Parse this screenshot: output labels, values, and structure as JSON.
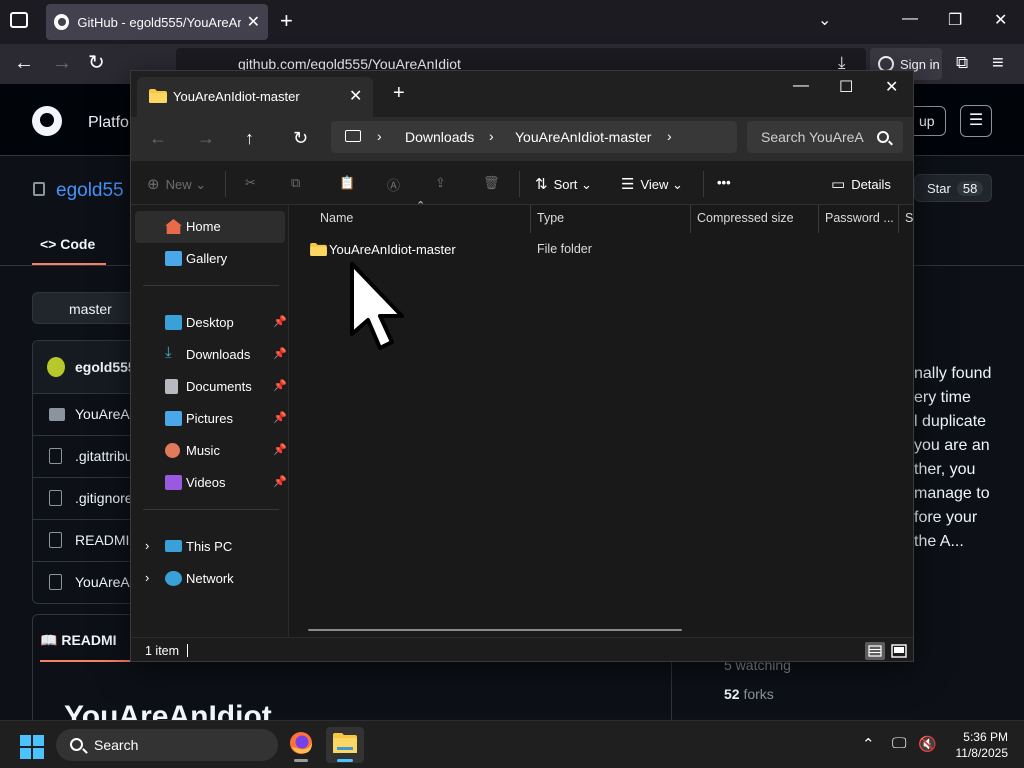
{
  "browser": {
    "tab_title": "GitHub - egold555/YouAreAnIdiot",
    "url": "github.com/egold555/YouAreAnIdiot",
    "sign_in": "Sign in"
  },
  "github": {
    "platform": "Platfo",
    "signup": "up",
    "repo_owner": "egold55",
    "star_label": "Star",
    "star_count": "58",
    "code_tab": "Code",
    "branch": "master",
    "commit_author": "egold555",
    "files": [
      "YouAreA",
      ".gitattribu",
      ".gitignore",
      "READMI",
      "YouAreA"
    ],
    "readme_tab": "READMI",
    "readme_heading": "YouAreAnIdiot",
    "about_lines": [
      "nally found",
      "ery time",
      "l duplicate",
      "you are an",
      "ther, you",
      "manage to",
      "fore your",
      "the A..."
    ],
    "watching": "5 watching",
    "forks_count": "52",
    "forks_label": "forks"
  },
  "explorer": {
    "tab_title": "YouAreAnIdiot-master",
    "path": [
      "Downloads",
      "YouAreAnIdiot-master"
    ],
    "search_placeholder": "Search YouAreA",
    "commands": {
      "new": "New",
      "sort": "Sort",
      "view": "View",
      "more": "•••",
      "details": "Details"
    },
    "nav": {
      "home": "Home",
      "gallery": "Gallery",
      "pinned": [
        "Desktop",
        "Downloads",
        "Documents",
        "Pictures",
        "Music",
        "Videos"
      ],
      "this_pc": "This PC",
      "network": "Network"
    },
    "columns": [
      "Name",
      "Type",
      "Compressed size",
      "Password ...",
      "Si"
    ],
    "items": [
      {
        "name": "YouAreAnIdiot-master",
        "type": "File folder"
      }
    ],
    "status": "1 item"
  },
  "taskbar": {
    "search": "Search",
    "time": "5:36 PM",
    "date": "11/8/2025"
  },
  "colors": {
    "folder": "#f8c840",
    "accent": "#4cc2ff",
    "github_link": "#4493f8",
    "underline": "#f78166"
  }
}
